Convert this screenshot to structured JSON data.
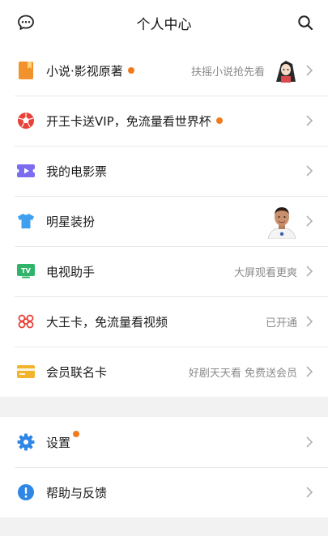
{
  "header": {
    "title": "个人中心",
    "left_icon": "message-icon",
    "right_icon": "search-icon"
  },
  "colors": {
    "accent_dot": "#f07a1c",
    "novel": "#f2922c",
    "worldcup": "#e8433a",
    "ticket": "#7b6cf0",
    "shirt": "#3fa0f0",
    "tv": "#2fb46a",
    "unicom": "#e8433a",
    "card": "#f2b42c",
    "settings": "#2e86e6",
    "help": "#2e86e6"
  },
  "menu": [
    {
      "label": "小说·影视原著",
      "dot": true,
      "right_text": "扶摇小说抢先看",
      "icon": "book-icon"
    },
    {
      "label": "开王卡送VIP，免流量看世界杯",
      "dot": true,
      "right_text": "",
      "icon": "soccer-ball-icon"
    },
    {
      "label": "我的电影票",
      "dot": false,
      "right_text": "",
      "icon": "movie-ticket-icon"
    },
    {
      "label": "明星装扮",
      "dot": false,
      "right_text": "",
      "icon": "tshirt-icon"
    },
    {
      "label": "电视助手",
      "dot": false,
      "right_text": "大屏观看更爽",
      "icon": "tv-icon"
    },
    {
      "label": "大王卡，免流量看视频",
      "dot": false,
      "right_text": "已开通",
      "icon": "unicom-logo-icon"
    },
    {
      "label": "会员联名卡",
      "dot": false,
      "right_text": "好剧天天看 免费送会员",
      "icon": "member-card-icon"
    }
  ],
  "settings_menu": [
    {
      "label": "设置",
      "dot": true,
      "icon": "gear-icon"
    },
    {
      "label": "帮助与反馈",
      "dot": false,
      "icon": "help-icon"
    }
  ],
  "tv_icon_text": "TV"
}
